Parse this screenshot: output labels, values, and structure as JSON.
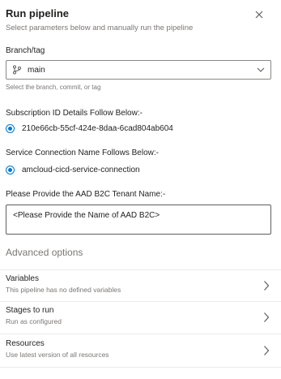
{
  "header": {
    "title": "Run pipeline",
    "subtitle": "Select parameters below and manually run the pipeline"
  },
  "branch": {
    "label": "Branch/tag",
    "value": "main",
    "hint": "Select the branch, commit, or tag"
  },
  "subscription": {
    "label": "Subscription ID Details Follow Below:-",
    "option": "210e66cb-55cf-424e-8daa-6cad804ab604"
  },
  "service_connection": {
    "label": "Service Connection Name Follows Below:-",
    "option": "amcloud-cicd-service-connection"
  },
  "tenant": {
    "label": "Please Provide the AAD B2C Tenant Name:-",
    "value": "<Please Provide the Name of AAD B2C>"
  },
  "advanced": {
    "title": "Advanced options",
    "items": [
      {
        "label": "Variables",
        "description": "This pipeline has no defined variables"
      },
      {
        "label": "Stages to run",
        "description": "Run as configured"
      },
      {
        "label": "Resources",
        "description": "Use latest version of all resources"
      }
    ]
  },
  "colors": {
    "accent": "#0078d4",
    "secondary_text": "#7a7775"
  }
}
